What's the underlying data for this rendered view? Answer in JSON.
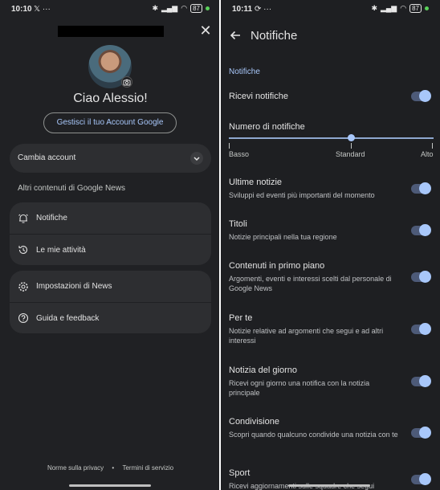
{
  "left": {
    "status": {
      "time": "10:10",
      "left_icons": "𝕏  ···",
      "battery": "87"
    },
    "close_label": "✕",
    "greeting": "Ciao Alessio!",
    "manage_account": "Gestisci il tuo Account Google",
    "switch_account": "Cambia account",
    "chevron": "⌄",
    "section_label": "Altri contenuti di Google News",
    "group1": [
      {
        "label": "Notifiche",
        "icon": "bell-icon"
      },
      {
        "label": "Le mie attività",
        "icon": "history-icon"
      }
    ],
    "group2": [
      {
        "label": "Impostazioni di News",
        "icon": "gear-icon"
      },
      {
        "label": "Guida e feedback",
        "icon": "help-icon"
      }
    ],
    "footer": {
      "privacy": "Norme sulla privacy",
      "sep": "•",
      "terms": "Termini di servizio"
    }
  },
  "right": {
    "status": {
      "time": "10:11",
      "left_icons": "⟳  ···",
      "battery": "87"
    },
    "title": "Notifiche",
    "section": "Notifiche",
    "receive": {
      "title": "Ricevi notifiche",
      "enabled": true
    },
    "count": {
      "title": "Numero di notifiche",
      "options": [
        "Basso",
        "Standard",
        "Alto"
      ],
      "selected": "Standard"
    },
    "settings": [
      {
        "title": "Ultime notizie",
        "subtitle": "Sviluppi ed eventi più importanti del momento",
        "enabled": true
      },
      {
        "title": "Titoli",
        "subtitle": "Notizie principali nella tua regione",
        "enabled": true
      },
      {
        "title": "Contenuti in primo piano",
        "subtitle": "Argomenti, eventi e interessi scelti dal personale di Google News",
        "enabled": true
      },
      {
        "title": "Per te",
        "subtitle": "Notizie relative ad argomenti che segui e ad altri interessi",
        "enabled": true
      },
      {
        "title": "Notizia del giorno",
        "subtitle": "Ricevi ogni giorno una notifica con la notizia principale",
        "enabled": true
      },
      {
        "title": "Condivisione",
        "subtitle": "Scopri quando qualcuno condivide una notizia con te",
        "enabled": true
      },
      {
        "title": "Sport",
        "subtitle": "Ricevi aggiornamenti sulle squadre che segui",
        "enabled": true
      }
    ]
  },
  "colors": {
    "accent": "#a8c7fa",
    "background": "#202124",
    "card": "#2d2e31"
  }
}
